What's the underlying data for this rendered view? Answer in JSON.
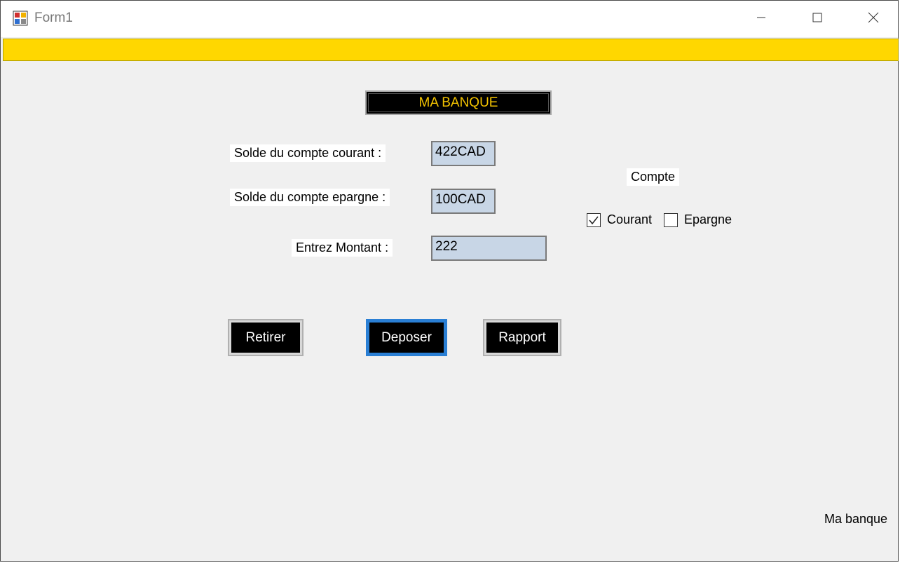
{
  "window": {
    "title": "Form1",
    "icons": {
      "app": "form-app-icon",
      "minimize": "minimize-icon",
      "maximize": "maximize-icon",
      "close": "close-icon"
    }
  },
  "colors": {
    "strip": "#ffd700",
    "title_text": "#f2c200",
    "field_bg": "#c8d6e6",
    "button_bg": "#000000",
    "focus": "#2a7fd4",
    "form_bg": "#f0f0f0"
  },
  "header": {
    "bank_title": "MA BANQUE"
  },
  "form": {
    "solde_courant_label": "Solde du compte courant :",
    "solde_courant_value": "422CAD",
    "solde_epargne_label": "Solde du compte epargne :",
    "solde_epargne_value": "100CAD",
    "montant_label": "Entrez Montant :",
    "montant_value": "222"
  },
  "compte": {
    "label": "Compte",
    "options": [
      {
        "label": "Courant",
        "checked": true
      },
      {
        "label": "Epargne",
        "checked": false
      }
    ]
  },
  "buttons": {
    "retirer": "Retirer",
    "deposer": "Deposer",
    "rapport": "Rapport"
  },
  "footer": {
    "label": "Ma banque"
  }
}
